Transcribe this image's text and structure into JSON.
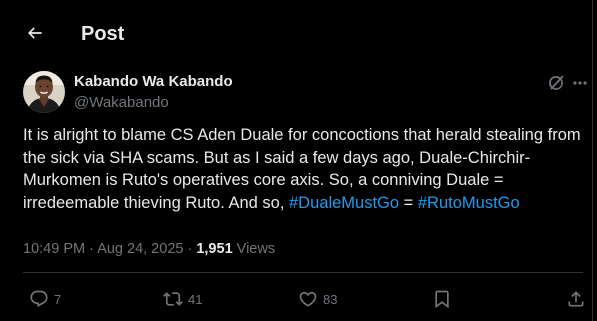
{
  "header": {
    "title": "Post"
  },
  "icons": {
    "back": "arrow-left-icon",
    "grok": "grok-icon",
    "more": "more-icon",
    "reply": "reply-icon",
    "repost": "repost-icon",
    "like": "like-icon",
    "bookmark": "bookmark-icon",
    "share": "share-icon"
  },
  "post": {
    "author": {
      "display_name": "Kabando Wa Kabando",
      "handle": "@Wakabando"
    },
    "text_part1": "It is alright to blame CS Aden Duale for concoctions that herald stealing from the sick via SHA scams. But as I said a few days ago, Duale-Chirchir-Murkomen is Ruto's operatives core axis. So, a conniving Duale = irredeemable thieving Ruto. And so, ",
    "hashtag1": "#DualeMustGo",
    "text_part2": " = ",
    "hashtag2": "#RutoMustGo",
    "time": "10:49 PM",
    "sep1": " · ",
    "date": "Aug 24, 2025",
    "sep2": " · ",
    "views_count": "1,951",
    "views_label": " Views"
  },
  "actions": {
    "replies": "7",
    "reposts": "41",
    "likes": "83"
  },
  "colors": {
    "background": "#000000",
    "text": "#e7e9ea",
    "muted": "#71767b",
    "link": "#1d9bf0",
    "border": "#2f3336"
  }
}
